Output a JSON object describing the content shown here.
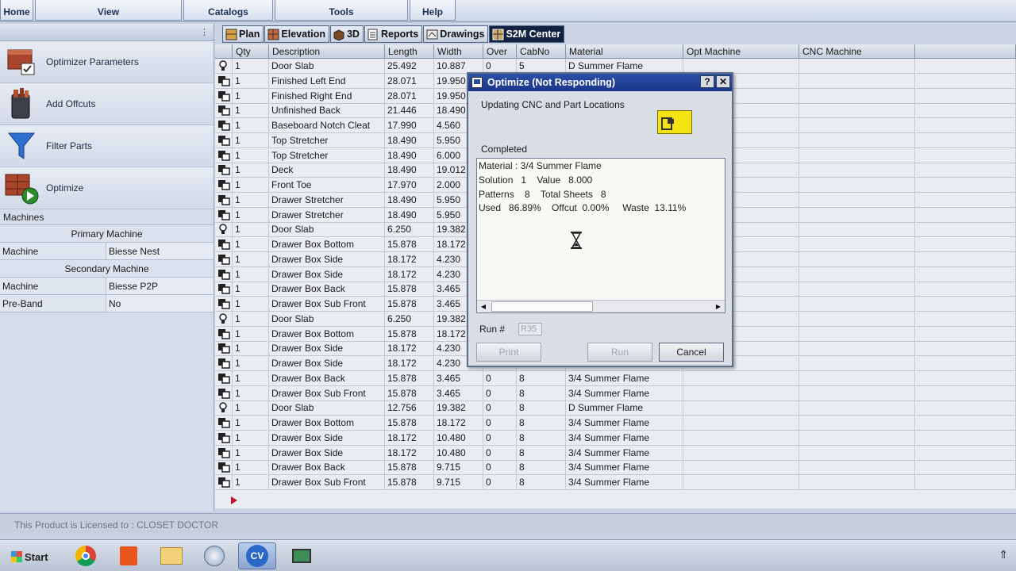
{
  "ribbon": {
    "tabs": [
      {
        "label": "Home"
      },
      {
        "label": "View"
      },
      {
        "label": "Catalogs"
      },
      {
        "label": "Tools"
      },
      {
        "label": "Help"
      }
    ]
  },
  "left_panel": {
    "items": [
      {
        "label": "Optimizer Parameters",
        "icon": "optimizer-parameters-icon"
      },
      {
        "label": "Add Offcuts",
        "icon": "add-offcuts-icon"
      },
      {
        "label": "Filter Parts",
        "icon": "filter-icon"
      },
      {
        "label": "Optimize",
        "icon": "optimize-play-icon"
      }
    ],
    "machines_label": "Machines",
    "primary_label": "Primary Machine",
    "primary": {
      "key": "Machine",
      "value": "Biesse Nest"
    },
    "secondary_label": "Secondary Machine",
    "secondary": {
      "key": "Machine",
      "value": "Biesse P2P"
    },
    "preband": {
      "key": "Pre-Band",
      "value": "No"
    }
  },
  "view_tabs": [
    {
      "label": "Plan",
      "icon": "plan-icon"
    },
    {
      "label": "Elevation",
      "icon": "elevation-icon"
    },
    {
      "label": "3D",
      "icon": "cube-3d-icon"
    },
    {
      "label": "Reports",
      "icon": "reports-icon"
    },
    {
      "label": "Drawings",
      "icon": "drawings-icon"
    },
    {
      "label": "S2M Center",
      "icon": "s2m-center-icon",
      "active": true
    }
  ],
  "grid": {
    "columns": [
      "Qty",
      "Description",
      "Length",
      "Width",
      "Over",
      "CabNo",
      "Material",
      "Opt Machine",
      "CNC Machine"
    ],
    "rows": [
      {
        "icon": "door-part-icon",
        "qty": "1",
        "desc": "Door Slab",
        "length": "25.492",
        "width": "10.887",
        "over": "0",
        "cab": "5",
        "mat": "D Summer Flame"
      },
      {
        "icon": "box-part-icon",
        "qty": "1",
        "desc": "Finished Left End",
        "length": "28.071",
        "width": "19.950",
        "over": "",
        "cab": "",
        "mat": ""
      },
      {
        "icon": "box-part-icon",
        "qty": "1",
        "desc": "Finished Right End",
        "length": "28.071",
        "width": "19.950",
        "over": "",
        "cab": "",
        "mat": ""
      },
      {
        "icon": "box-part-icon",
        "qty": "1",
        "desc": "Unfinished Back",
        "length": "21.446",
        "width": "18.490",
        "over": "",
        "cab": "",
        "mat": ""
      },
      {
        "icon": "box-part-icon",
        "qty": "1",
        "desc": "Baseboard Notch Cleat",
        "length": "17.990",
        "width": "4.560",
        "over": "",
        "cab": "",
        "mat": ""
      },
      {
        "icon": "box-part-icon",
        "qty": "1",
        "desc": "Top Stretcher",
        "length": "18.490",
        "width": "5.950",
        "over": "",
        "cab": "",
        "mat": ""
      },
      {
        "icon": "box-part-icon",
        "qty": "1",
        "desc": "Top Stretcher",
        "length": "18.490",
        "width": "6.000",
        "over": "",
        "cab": "",
        "mat": ""
      },
      {
        "icon": "box-part-icon",
        "qty": "1",
        "desc": "Deck",
        "length": "18.490",
        "width": "19.012",
        "over": "",
        "cab": "",
        "mat": ""
      },
      {
        "icon": "box-part-icon",
        "qty": "1",
        "desc": "Front Toe",
        "length": "17.970",
        "width": "2.000",
        "over": "",
        "cab": "",
        "mat": ""
      },
      {
        "icon": "box-part-icon",
        "qty": "1",
        "desc": "Drawer Stretcher",
        "length": "18.490",
        "width": "5.950",
        "over": "",
        "cab": "",
        "mat": ""
      },
      {
        "icon": "box-part-icon",
        "qty": "1",
        "desc": "Drawer Stretcher",
        "length": "18.490",
        "width": "5.950",
        "over": "",
        "cab": "",
        "mat": ""
      },
      {
        "icon": "door-part-icon",
        "qty": "1",
        "desc": "Door Slab",
        "length": "6.250",
        "width": "19.382",
        "over": "",
        "cab": "",
        "mat": ""
      },
      {
        "icon": "box-part-icon",
        "qty": "1",
        "desc": "Drawer Box Bottom",
        "length": "15.878",
        "width": "18.172",
        "over": "",
        "cab": "",
        "mat": ""
      },
      {
        "icon": "box-part-icon",
        "qty": "1",
        "desc": "Drawer Box Side",
        "length": "18.172",
        "width": "4.230",
        "over": "",
        "cab": "",
        "mat": ""
      },
      {
        "icon": "box-part-icon",
        "qty": "1",
        "desc": "Drawer Box Side",
        "length": "18.172",
        "width": "4.230",
        "over": "",
        "cab": "",
        "mat": ""
      },
      {
        "icon": "box-part-icon",
        "qty": "1",
        "desc": "Drawer Box Back",
        "length": "15.878",
        "width": "3.465",
        "over": "",
        "cab": "",
        "mat": ""
      },
      {
        "icon": "box-part-icon",
        "qty": "1",
        "desc": "Drawer Box Sub Front",
        "length": "15.878",
        "width": "3.465",
        "over": "",
        "cab": "",
        "mat": ""
      },
      {
        "icon": "door-part-icon",
        "qty": "1",
        "desc": "Door Slab",
        "length": "6.250",
        "width": "19.382",
        "over": "",
        "cab": "",
        "mat": ""
      },
      {
        "icon": "box-part-icon",
        "qty": "1",
        "desc": "Drawer Box Bottom",
        "length": "15.878",
        "width": "18.172",
        "over": "",
        "cab": "",
        "mat": ""
      },
      {
        "icon": "box-part-icon",
        "qty": "1",
        "desc": "Drawer Box Side",
        "length": "18.172",
        "width": "4.230",
        "over": "",
        "cab": "",
        "mat": ""
      },
      {
        "icon": "box-part-icon",
        "qty": "1",
        "desc": "Drawer Box Side",
        "length": "18.172",
        "width": "4.230",
        "over": "",
        "cab": "",
        "mat": ""
      },
      {
        "icon": "box-part-icon",
        "qty": "1",
        "desc": "Drawer Box Back",
        "length": "15.878",
        "width": "3.465",
        "over": "0",
        "cab": "8",
        "mat": "3/4 Summer Flame"
      },
      {
        "icon": "box-part-icon",
        "qty": "1",
        "desc": "Drawer Box Sub Front",
        "length": "15.878",
        "width": "3.465",
        "over": "0",
        "cab": "8",
        "mat": "3/4 Summer Flame"
      },
      {
        "icon": "door-part-icon",
        "qty": "1",
        "desc": "Door Slab",
        "length": "12.756",
        "width": "19.382",
        "over": "0",
        "cab": "8",
        "mat": "D Summer Flame"
      },
      {
        "icon": "box-part-icon",
        "qty": "1",
        "desc": "Drawer Box Bottom",
        "length": "15.878",
        "width": "18.172",
        "over": "0",
        "cab": "8",
        "mat": "3/4 Summer Flame"
      },
      {
        "icon": "box-part-icon",
        "qty": "1",
        "desc": "Drawer Box Side",
        "length": "18.172",
        "width": "10.480",
        "over": "0",
        "cab": "8",
        "mat": "3/4 Summer Flame"
      },
      {
        "icon": "box-part-icon",
        "qty": "1",
        "desc": "Drawer Box Side",
        "length": "18.172",
        "width": "10.480",
        "over": "0",
        "cab": "8",
        "mat": "3/4 Summer Flame"
      },
      {
        "icon": "box-part-icon",
        "qty": "1",
        "desc": "Drawer Box Back",
        "length": "15.878",
        "width": "9.715",
        "over": "0",
        "cab": "8",
        "mat": "3/4 Summer Flame"
      },
      {
        "icon": "box-part-icon",
        "qty": "1",
        "desc": "Drawer Box Sub Front",
        "length": "15.878",
        "width": "9.715",
        "over": "0",
        "cab": "8",
        "mat": "3/4 Summer Flame"
      }
    ]
  },
  "dialog": {
    "title": "Optimize (Not Responding)",
    "help_label": "?",
    "close_label": "✕",
    "status": "Updating CNC and Part Locations",
    "completed_label": "Completed",
    "log_lines": [
      "Material : 3/4 Summer Flame",
      "Solution   1    Value   8.000",
      "Patterns    8    Total Sheets   8",
      "Used   86.89%    Offcut  0.00%     Waste  13.11%"
    ],
    "run_label": "Run #",
    "run_value": "R35",
    "print_label": "Print",
    "run_button": "Run",
    "cancel_label": "Cancel"
  },
  "footer": {
    "license": "This Product is Licensed to : CLOSET DOCTOR"
  },
  "taskbar": {
    "start_label": "Start",
    "apps": [
      "chrome-icon",
      "office-icon",
      "folder-icon",
      "browser-icon",
      "cv-app-icon",
      "monitor-app-icon"
    ],
    "cv_label": "CV",
    "tray_icon": "tray-arrow-icon",
    "tray_glyph": "⇑"
  }
}
